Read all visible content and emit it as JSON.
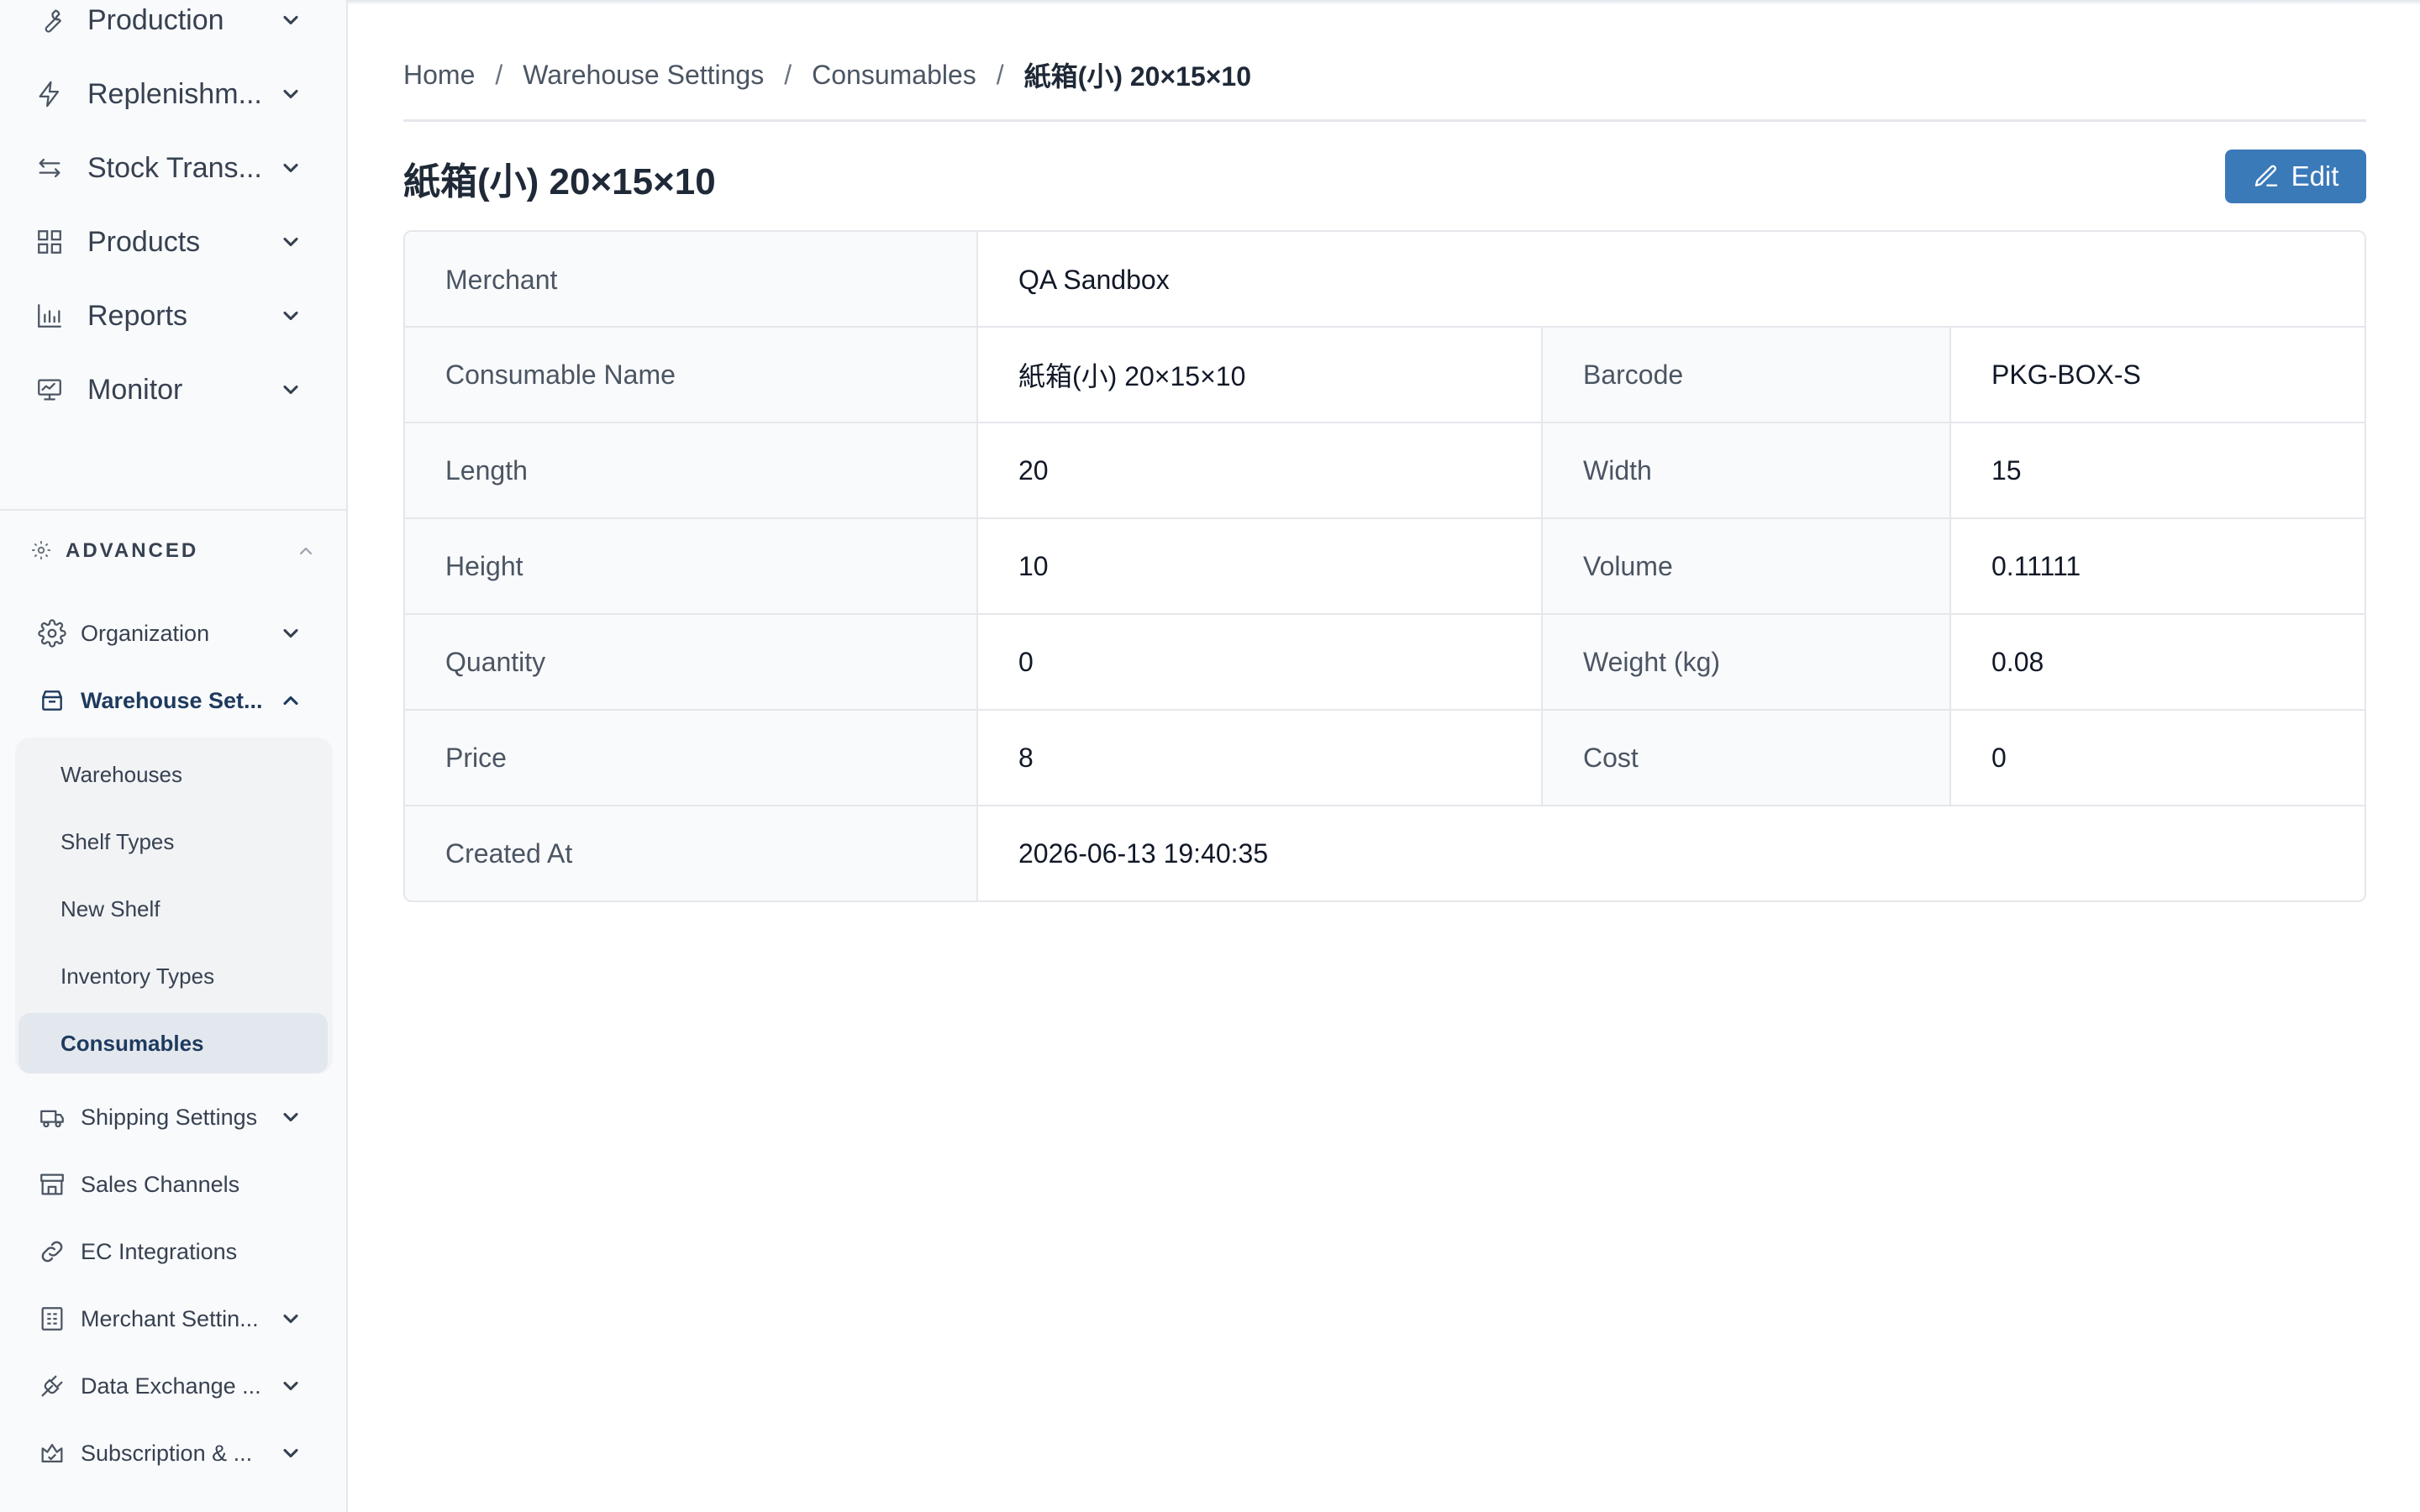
{
  "sidebar": {
    "main_items": [
      {
        "label": "Production",
        "icon": "wrench-icon"
      },
      {
        "label": "Replenishm...",
        "icon": "lightning-icon"
      },
      {
        "label": "Stock Trans...",
        "icon": "transfer-icon"
      },
      {
        "label": "Products",
        "icon": "grid-icon"
      },
      {
        "label": "Reports",
        "icon": "bar-chart-icon"
      },
      {
        "label": "Monitor",
        "icon": "monitor-icon"
      }
    ],
    "advanced": {
      "label": "ADVANCED",
      "items": [
        {
          "label": "Organization"
        },
        {
          "label": "Warehouse Set..."
        },
        {
          "label": "Shipping Settings"
        },
        {
          "label": "Sales Channels"
        },
        {
          "label": "EC Integrations"
        },
        {
          "label": "Merchant Settin..."
        },
        {
          "label": "Data Exchange ..."
        },
        {
          "label": "Subscription & ..."
        }
      ],
      "warehouse_children": [
        {
          "label": "Warehouses"
        },
        {
          "label": "Shelf Types"
        },
        {
          "label": "New Shelf"
        },
        {
          "label": "Inventory Types"
        },
        {
          "label": "Consumables"
        }
      ]
    }
  },
  "breadcrumb": {
    "home": "Home",
    "warehouse_settings": "Warehouse Settings",
    "consumables": "Consumables",
    "current": "紙箱(小) 20×15×10",
    "separator": "/"
  },
  "page": {
    "title": "紙箱(小) 20×15×10",
    "edit_label": "Edit"
  },
  "details": {
    "merchant": {
      "label": "Merchant",
      "value": "QA Sandbox"
    },
    "consumable_name": {
      "label": "Consumable Name",
      "value": "紙箱(小) 20×15×10"
    },
    "barcode": {
      "label": "Barcode",
      "value": "PKG-BOX-S"
    },
    "length": {
      "label": "Length",
      "value": "20"
    },
    "width": {
      "label": "Width",
      "value": "15"
    },
    "height": {
      "label": "Height",
      "value": "10"
    },
    "volume": {
      "label": "Volume",
      "value": "0.11111"
    },
    "quantity": {
      "label": "Quantity",
      "value": "0"
    },
    "weight": {
      "label": "Weight (kg)",
      "value": "0.08"
    },
    "price": {
      "label": "Price",
      "value": "8"
    },
    "cost": {
      "label": "Cost",
      "value": "0"
    },
    "created_at": {
      "label": "Created At",
      "value": "2026-06-13 19:40:35"
    }
  },
  "colors": {
    "primary": "#3b7ab9",
    "active_text": "#1e3a5f"
  }
}
